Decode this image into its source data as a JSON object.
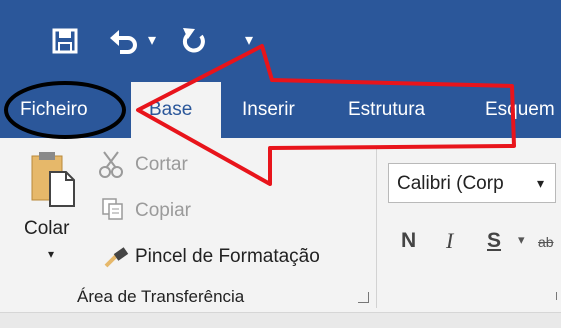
{
  "qat": {
    "save_icon": "save-icon",
    "undo_icon": "undo-icon",
    "undo_dropdown": "▾",
    "redo_icon": "redo-icon",
    "customize": "▾"
  },
  "tabs": [
    "Ficheiro",
    "Base",
    "Inserir",
    "Estrutura",
    "Esquem"
  ],
  "clipboard": {
    "paste_label": "Colar",
    "cut_label": "Cortar",
    "copy_label": "Copiar",
    "format_painter_label": "Pincel de Formatação",
    "group_label": "Área de Transferência"
  },
  "font": {
    "font_name": "Calibri (Corp",
    "bold": "N",
    "italic": "I",
    "underline": "S",
    "dropdown": "▾",
    "strike": "ab"
  },
  "colors": {
    "title_bar": "#2b579a",
    "ribbon": "#f3f3f3",
    "annotation_arrow": "#e8141b",
    "annotation_circle": "#000000"
  }
}
